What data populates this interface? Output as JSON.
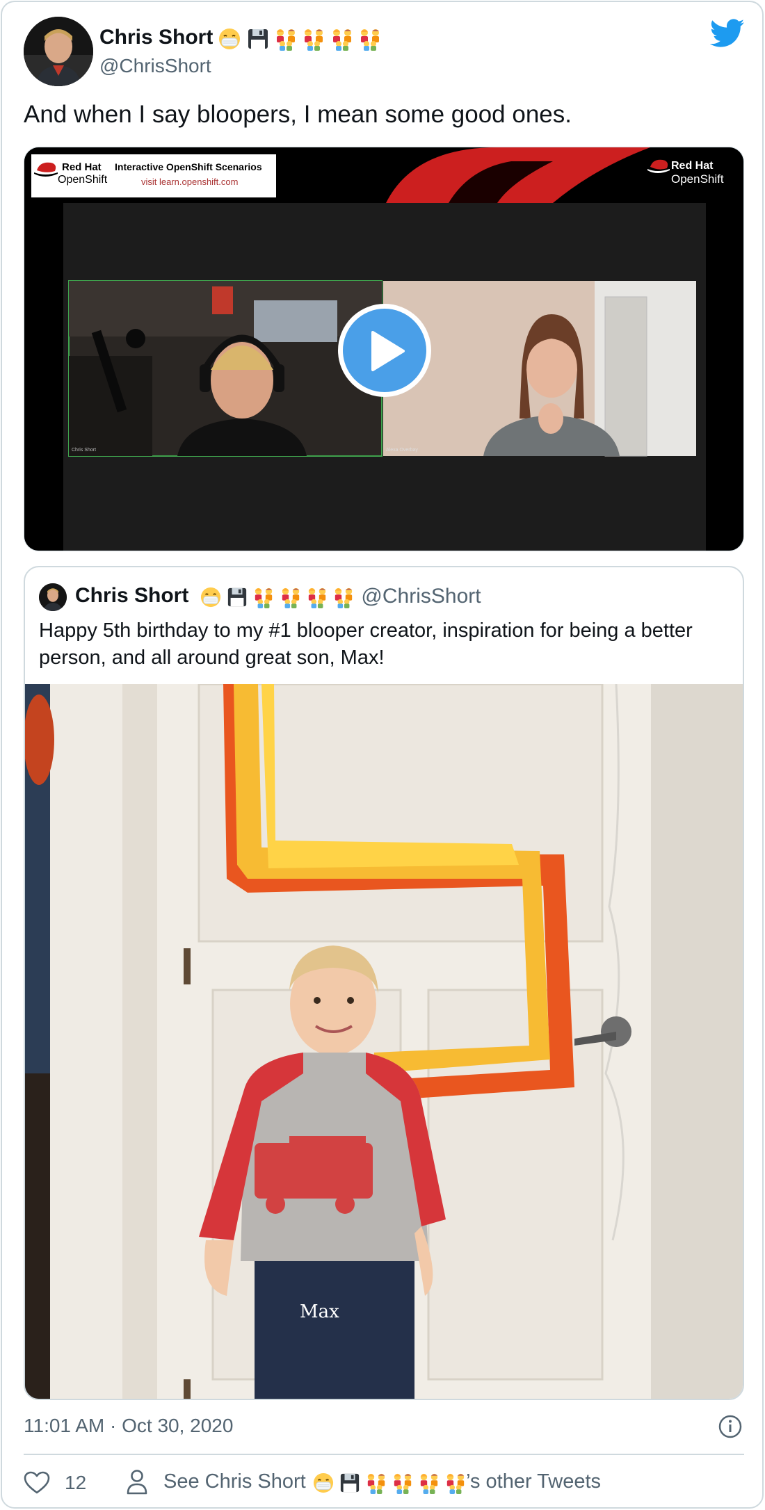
{
  "author": {
    "name": "Chris Short",
    "handle": "@ChrisShort"
  },
  "tweet": {
    "text": "And when I say bloopers, I mean some good ones."
  },
  "video": {
    "banner_brand_top": "Red Hat",
    "banner_brand_bottom": "OpenShift",
    "banner_title": "Interactive OpenShift Scenarios",
    "banner_subtitle": "visit learn.openshift.com",
    "corner_brand_top": "Red Hat",
    "corner_brand_bottom": "OpenShift",
    "left_caption": "Chris Short",
    "right_caption": "Alexa Overbay"
  },
  "quoted_tweet": {
    "name": "Chris Short",
    "handle": "@ChrisShort",
    "text": "Happy 5th birthday to my #1 blooper creator, inspiration for being a better person, and all around great son, Max!",
    "shirt_text": "Max"
  },
  "footer": {
    "timestamp": "11:01 AM · Oct 30, 2020",
    "like_count": "12",
    "see_prefix": "See Chris Short",
    "see_suffix": "’s other Tweets"
  },
  "colors": {
    "twitter_blue": "#1d9bf0",
    "secondary_text": "#536471",
    "border": "#cfd9de"
  },
  "icons": [
    "twitter-logo-icon",
    "play-icon",
    "info-icon",
    "heart-icon",
    "person-icon",
    "mask-emoji-icon",
    "floppy-disk-emoji-icon",
    "family-emoji-icon"
  ]
}
